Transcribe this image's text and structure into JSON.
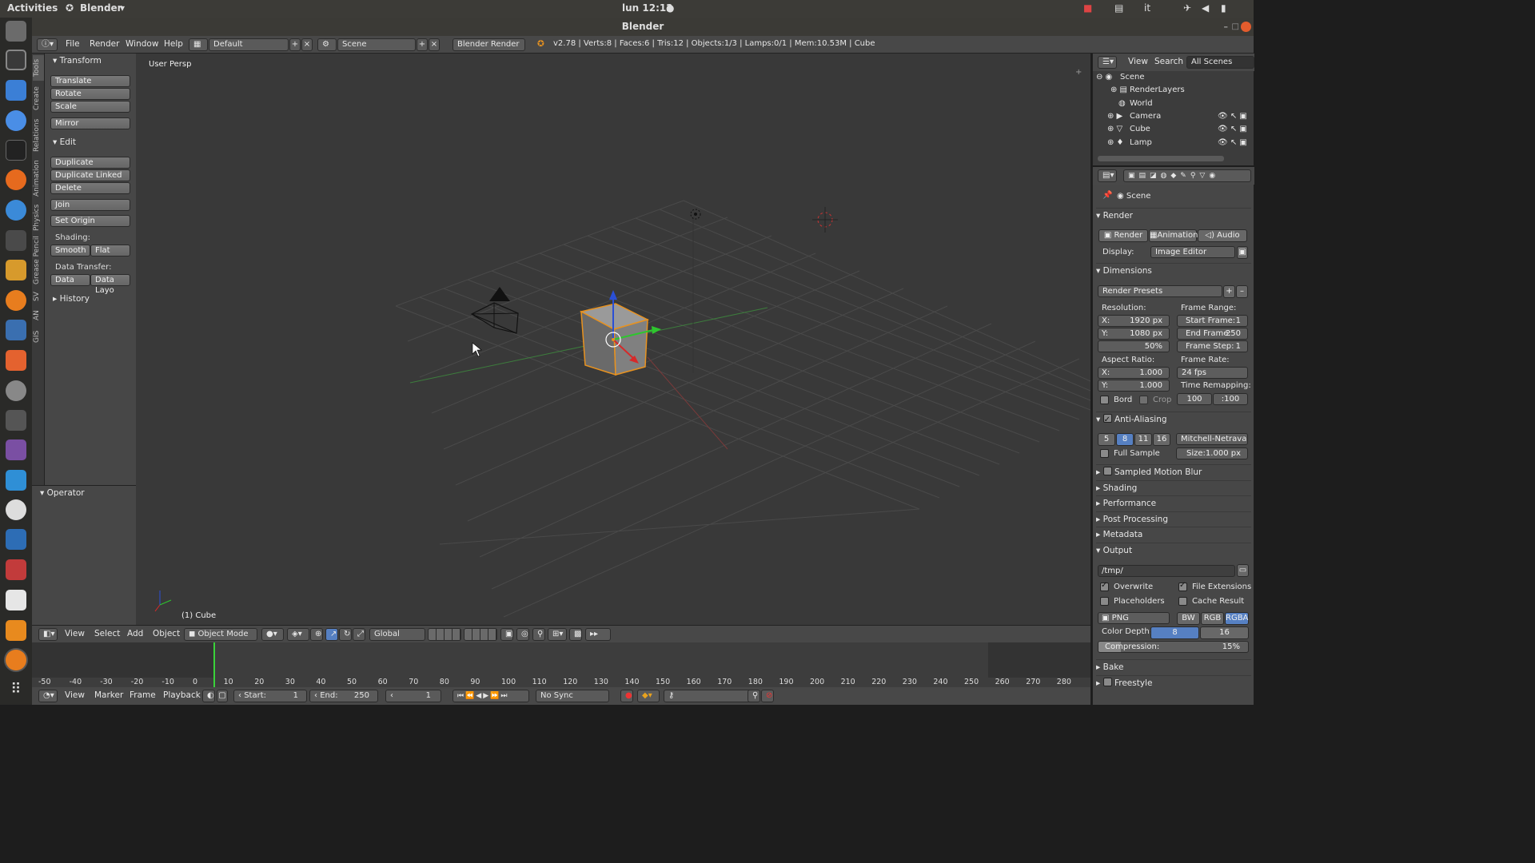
{
  "system_bar": {
    "activities": "Activities",
    "app": "Blender",
    "clock": "lun 12:12",
    "lang": "it"
  },
  "window_title": "Blender",
  "info_header": {
    "menus": [
      "File",
      "Render",
      "Window",
      "Help"
    ],
    "screen_layout": "Default",
    "scene": "Scene",
    "engine": "Blender Render",
    "stats": "v2.78 | Verts:8 | Faces:6 | Tris:12 | Objects:1/3 | Lamps:0/1 | Mem:10.53M | Cube"
  },
  "tool_tabs": [
    "Tools",
    "Create",
    "Relations",
    "Animation",
    "Physics",
    "Grease Pencil",
    "SV",
    "AN",
    "GIS"
  ],
  "tool_shelf": {
    "transform_header": "Transform",
    "translate": "Translate",
    "rotate": "Rotate",
    "scale": "Scale",
    "mirror": "Mirror",
    "edit_header": "Edit",
    "duplicate": "Duplicate",
    "duplicate_linked": "Duplicate Linked",
    "delete": "Delete",
    "join": "Join",
    "set_origin": "Set Origin",
    "shading_label": "Shading:",
    "smooth": "Smooth",
    "flat": "Flat",
    "data_transfer_label": "Data Transfer:",
    "data": "Data",
    "data_layo": "Data Layo",
    "history_header": "History"
  },
  "operator_header": "Operator",
  "viewport": {
    "view_name": "User Persp",
    "object_label": "(1) Cube"
  },
  "view3d_header": {
    "menus": [
      "View",
      "Select",
      "Add",
      "Object"
    ],
    "mode": "Object Mode",
    "orientation": "Global"
  },
  "timeline": {
    "ticks": [
      "-50",
      "-40",
      "-30",
      "-20",
      "-10",
      "0",
      "10",
      "20",
      "30",
      "40",
      "50",
      "60",
      "70",
      "80",
      "90",
      "100",
      "110",
      "120",
      "130",
      "140",
      "150",
      "160",
      "170",
      "180",
      "190",
      "200",
      "210",
      "220",
      "230",
      "240",
      "250",
      "260",
      "270",
      "280"
    ],
    "menus": [
      "View",
      "Marker",
      "Frame",
      "Playback"
    ],
    "start_label": "Start:",
    "start": "1",
    "end_label": "End:",
    "end": "250",
    "current": "1",
    "sync": "No Sync"
  },
  "outliner": {
    "menus": [
      "View",
      "Search"
    ],
    "filter": "All Scenes",
    "items": [
      "Scene",
      "RenderLayers",
      "World",
      "Camera",
      "Cube",
      "Lamp"
    ]
  },
  "properties": {
    "scene": "Scene",
    "render_header": "Render",
    "render_btn": "Render",
    "animation_btn": "Animation",
    "audio_btn": "Audio",
    "display_label": "Display:",
    "display": "Image Editor",
    "dimensions_header": "Dimensions",
    "render_presets": "Render Presets",
    "resolution_label": "Resolution:",
    "res_x": "X:",
    "res_x_val": "1920 px",
    "res_y": "Y:",
    "res_y_val": "1080 px",
    "res_pct": "50%",
    "frame_range_label": "Frame Range:",
    "start_frame": "Start Frame:",
    "start_frame_val": "1",
    "end_frame": "End Frame:",
    "end_frame_val": "250",
    "frame_step": "Frame Step:",
    "frame_step_val": "1",
    "aspect_label": "Aspect Ratio:",
    "asp_x": "X:",
    "asp_x_val": "1.000",
    "asp_y": "Y:",
    "asp_y_val": "1.000",
    "frame_rate_label": "Frame Rate:",
    "frame_rate": "24 fps",
    "time_remap_label": "Time Remapping:",
    "remap_old": "100",
    "remap_new": ":100",
    "bord": "Bord",
    "crop": "Crop",
    "aa_header": "Anti-Aliasing",
    "aa_samples": [
      "5",
      "8",
      "11",
      "16"
    ],
    "aa_filter": "Mitchell-Netravali",
    "full_sample": "Full Sample",
    "aa_size": "Size:",
    "aa_size_val": "1.000 px",
    "motion_blur": "Sampled Motion Blur",
    "shading": "Shading",
    "performance": "Performance",
    "post_processing": "Post Processing",
    "metadata": "Metadata",
    "output_header": "Output",
    "output_path": "/tmp/",
    "overwrite": "Overwrite",
    "file_extensions": "File Extensions",
    "placeholders": "Placeholders",
    "cache_result": "Cache Result",
    "format": "PNG",
    "bw": "BW",
    "rgb": "RGB",
    "rgba": "RGBA",
    "color_depth_label": "Color Depth:",
    "depth_8": "8",
    "depth_16": "16",
    "compression": "Compression:",
    "compression_val": "15%",
    "bake": "Bake",
    "freestyle": "Freestyle"
  },
  "colors": {
    "accent": "#5680c2",
    "selection": "#e8921f"
  }
}
